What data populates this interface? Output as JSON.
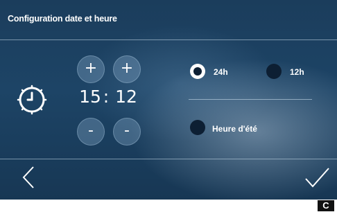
{
  "header": {
    "title": "Configuration date et heure"
  },
  "time": {
    "hours": "15",
    "separator": ":",
    "minutes": "12",
    "increment_symbol": "+",
    "decrement_symbol": "-"
  },
  "format": {
    "options": [
      {
        "label": "24h",
        "selected": true
      },
      {
        "label": "12h",
        "selected": false
      }
    ]
  },
  "dst": {
    "label": "Heure d'été",
    "checked": false
  },
  "footer": {
    "back_icon": "chevron-left-icon",
    "confirm_icon": "checkmark-icon"
  },
  "badge": {
    "label": "C"
  },
  "colors": {
    "background": "#1d4466",
    "accent": "#ffffff",
    "radio_fill": "#0d1f33"
  }
}
